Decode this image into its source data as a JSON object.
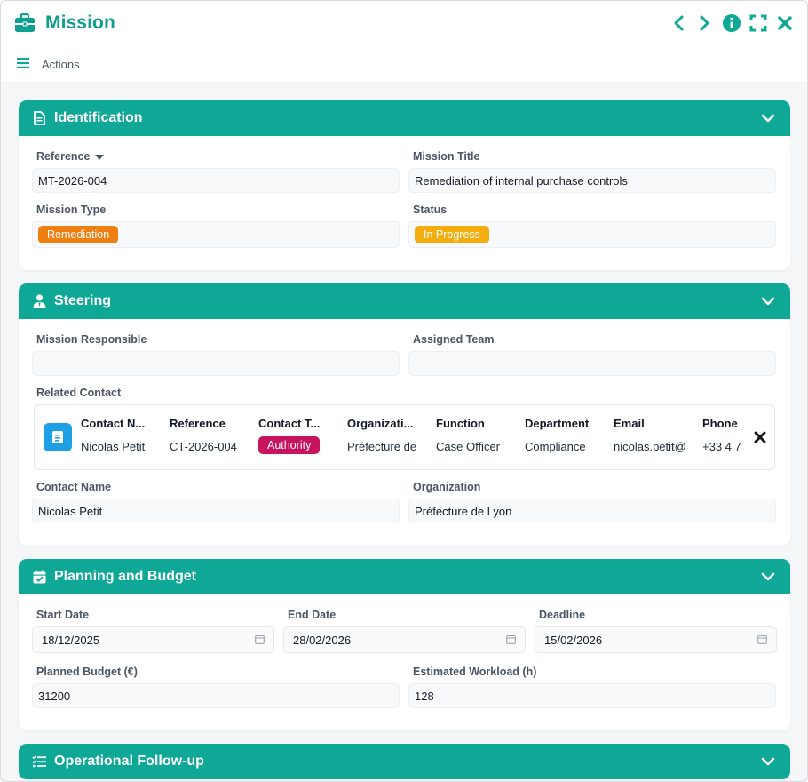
{
  "window": {
    "title": "Mission",
    "actions_label": "Actions"
  },
  "sections": {
    "identification": {
      "title": "Identification",
      "reference_label": "Reference",
      "reference_value": "MT-2026-004",
      "mission_title_label": "Mission Title",
      "mission_title_value": "Remediation of internal purchase controls",
      "mission_type_label": "Mission Type",
      "mission_type_value": "Remediation",
      "status_label": "Status",
      "status_value": "In Progress"
    },
    "steering": {
      "title": "Steering",
      "responsible_label": "Mission Responsible",
      "responsible_value": "",
      "team_label": "Assigned Team",
      "team_value": "",
      "related_contact_label": "Related Contact",
      "contact_table": {
        "headers": [
          "Contact N...",
          "Reference",
          "Contact T...",
          "Organizati...",
          "Function",
          "Department",
          "Email",
          "Phone"
        ],
        "row": {
          "name": "Nicolas Petit",
          "reference": "CT-2026-004",
          "type": "Authority",
          "organization": "Préfecture de",
          "function": "Case Officer",
          "department": "Compliance",
          "email": "nicolas.petit@",
          "phone": "+33 4 7"
        }
      },
      "contact_name_label": "Contact Name",
      "contact_name_value": "Nicolas Petit",
      "organization_label": "Organization",
      "organization_value": "Préfecture de Lyon"
    },
    "planning": {
      "title": "Planning and Budget",
      "start_label": "Start Date",
      "start_value": "18/12/2025",
      "end_label": "End Date",
      "end_value": "28/02/2026",
      "deadline_label": "Deadline",
      "deadline_value": "15/02/2026",
      "budget_label": "Planned Budget (€)",
      "budget_value": "31200",
      "workload_label": "Estimated Workload (h)",
      "workload_value": "128"
    },
    "followup": {
      "title": "Operational Follow-up"
    }
  },
  "colors": {
    "accent": "#0fa896",
    "title": "#0e9f8e",
    "remediation": "#f07f12",
    "in_progress": "#f3ad0e",
    "authority": "#c8135f",
    "contact_icon": "#1ea0e6"
  },
  "icons": {
    "app": "briefcase-icon",
    "identification": "document-icon",
    "steering": "user-tie-icon",
    "planning": "calendar-check-icon",
    "followup": "list-check-icon"
  }
}
